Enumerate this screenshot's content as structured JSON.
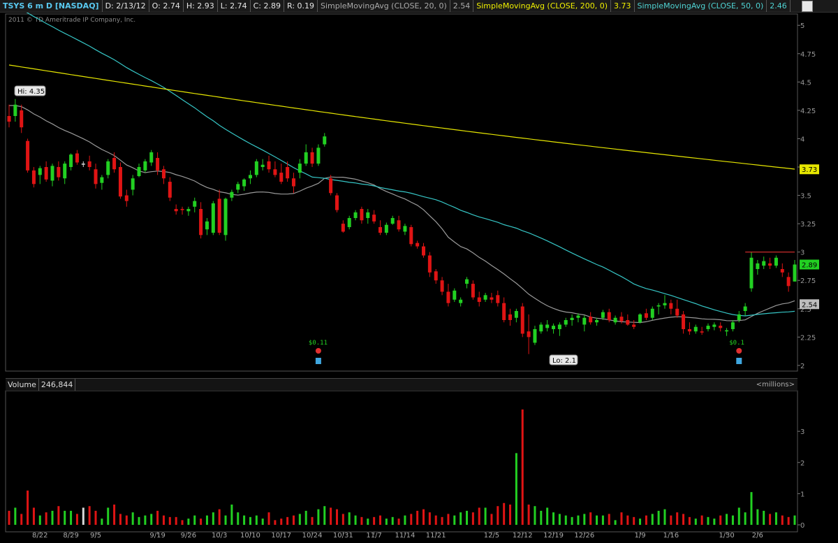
{
  "header": {
    "symbol": "TSYS 6 m D [NASDAQ]",
    "date": "D: 2/13/12",
    "open": "O: 2.74",
    "high": "H: 2.93",
    "low": "L: 2.74",
    "close": "C: 2.89",
    "range": "R: 0.19",
    "sma20_label": "SimpleMovingAvg (CLOSE, 20, 0)",
    "sma20_value": "2.54",
    "sma200_label": "SimpleMovingAvg (CLOSE, 200, 0)",
    "sma200_value": "3.73",
    "sma50_label": "SimpleMovingAvg (CLOSE, 50, 0)",
    "sma50_value": "2.46"
  },
  "copyright": "2011 © TD Ameritrade IP Company, Inc.",
  "volume_panel": {
    "label": "Volume",
    "value": "246,844",
    "units": "<millions>"
  },
  "annotations": {
    "hi": "Hi: 4.35",
    "lo": "Lo: 2.1",
    "dividend1": "$0.11",
    "dividend2": "$0.1",
    "badge_last": "2.89",
    "badge_sma200": "3.73",
    "badge_sma20": "2.54"
  },
  "colors": {
    "up": "#22d022",
    "down": "#e01414",
    "neutral": "#d8d8d8",
    "sma20": "#9a9a9a",
    "sma50": "#36c6c6",
    "sma200": "#e6e600",
    "resistance": "#e03030"
  },
  "chart_data": {
    "type": "candlestick",
    "y_ticks": [
      "5",
      "4.75",
      "4.5",
      "4.25",
      "4",
      "3.75",
      "3.5",
      "3.25",
      "3",
      "2.75",
      "2.5",
      "2.25",
      "2"
    ],
    "ylim": [
      1.95,
      5.1
    ],
    "volume_ticks": [
      "3",
      "2",
      "1",
      "0"
    ],
    "volume_ylim": [
      0,
      3.9
    ],
    "x_tick_labels": [
      {
        "label": "8/22",
        "i": 5
      },
      {
        "label": "8/29",
        "i": 10
      },
      {
        "label": "9/5",
        "i": 14
      },
      {
        "label": "9/19",
        "i": 24
      },
      {
        "label": "9/26",
        "i": 29
      },
      {
        "label": "10/3",
        "i": 34
      },
      {
        "label": "10/10",
        "i": 39
      },
      {
        "label": "10/17",
        "i": 44
      },
      {
        "label": "10/24",
        "i": 49
      },
      {
        "label": "10/31",
        "i": 54
      },
      {
        "label": "11/7",
        "i": 59
      },
      {
        "label": "11/14",
        "i": 64
      },
      {
        "label": "11/21",
        "i": 69
      },
      {
        "label": "12/5",
        "i": 78
      },
      {
        "label": "12/12",
        "i": 83
      },
      {
        "label": "12/19",
        "i": 88
      },
      {
        "label": "12/26",
        "i": 93
      },
      {
        "label": "1/9",
        "i": 102
      },
      {
        "label": "1/16",
        "i": 107
      },
      {
        "label": "1/30",
        "i": 116
      },
      {
        "label": "2/6",
        "i": 121
      }
    ],
    "ohlc": [
      [
        4.2,
        4.3,
        4.1,
        4.15
      ],
      [
        4.2,
        4.35,
        4.15,
        4.3
      ],
      [
        4.25,
        4.3,
        4.05,
        4.1
      ],
      [
        3.98,
        4.0,
        3.7,
        3.72
      ],
      [
        3.72,
        3.75,
        3.57,
        3.6
      ],
      [
        3.68,
        3.76,
        3.6,
        3.74
      ],
      [
        3.75,
        3.8,
        3.62,
        3.64
      ],
      [
        3.63,
        3.78,
        3.58,
        3.76
      ],
      [
        3.75,
        3.8,
        3.63,
        3.66
      ],
      [
        3.65,
        3.8,
        3.6,
        3.78
      ],
      [
        3.75,
        3.87,
        3.72,
        3.86
      ],
      [
        3.87,
        3.9,
        3.77,
        3.79
      ],
      [
        3.78,
        3.8,
        3.75,
        3.78
      ],
      [
        3.8,
        3.85,
        3.72,
        3.75
      ],
      [
        3.73,
        3.78,
        3.56,
        3.6
      ],
      [
        3.61,
        3.68,
        3.55,
        3.66
      ],
      [
        3.68,
        3.82,
        3.65,
        3.8
      ],
      [
        3.83,
        3.88,
        3.7,
        3.73
      ],
      [
        3.75,
        3.79,
        3.47,
        3.49
      ],
      [
        3.5,
        3.55,
        3.4,
        3.45
      ],
      [
        3.55,
        3.68,
        3.5,
        3.65
      ],
      [
        3.67,
        3.78,
        3.66,
        3.75
      ],
      [
        3.72,
        3.82,
        3.7,
        3.8
      ],
      [
        3.79,
        3.9,
        3.76,
        3.88
      ],
      [
        3.83,
        3.88,
        3.68,
        3.72
      ],
      [
        3.73,
        3.76,
        3.6,
        3.65
      ],
      [
        3.62,
        3.66,
        3.45,
        3.48
      ],
      [
        3.38,
        3.42,
        3.33,
        3.36
      ],
      [
        3.38,
        3.4,
        3.33,
        3.37
      ],
      [
        3.36,
        3.4,
        3.32,
        3.38
      ],
      [
        3.4,
        3.48,
        3.35,
        3.45
      ],
      [
        3.38,
        3.44,
        3.12,
        3.15
      ],
      [
        3.2,
        3.3,
        3.15,
        3.27
      ],
      [
        3.17,
        3.45,
        3.15,
        3.43
      ],
      [
        3.47,
        3.55,
        3.15,
        3.17
      ],
      [
        3.15,
        3.48,
        3.1,
        3.47
      ],
      [
        3.48,
        3.55,
        3.45,
        3.53
      ],
      [
        3.55,
        3.62,
        3.52,
        3.6
      ],
      [
        3.58,
        3.65,
        3.54,
        3.64
      ],
      [
        3.65,
        3.72,
        3.6,
        3.68
      ],
      [
        3.68,
        3.82,
        3.66,
        3.8
      ],
      [
        3.75,
        3.82,
        3.72,
        3.77
      ],
      [
        3.8,
        3.85,
        3.7,
        3.73
      ],
      [
        3.73,
        3.8,
        3.66,
        3.68
      ],
      [
        3.7,
        3.78,
        3.6,
        3.62
      ],
      [
        3.75,
        3.8,
        3.62,
        3.65
      ],
      [
        3.65,
        3.7,
        3.52,
        3.58
      ],
      [
        3.7,
        3.82,
        3.65,
        3.78
      ],
      [
        3.78,
        3.95,
        3.76,
        3.88
      ],
      [
        3.88,
        3.92,
        3.75,
        3.78
      ],
      [
        3.78,
        3.95,
        3.76,
        3.92
      ],
      [
        3.95,
        4.05,
        3.93,
        4.02
      ],
      [
        3.65,
        3.68,
        3.5,
        3.52
      ],
      [
        3.5,
        3.52,
        3.35,
        3.37
      ],
      [
        3.25,
        3.28,
        3.17,
        3.18
      ],
      [
        3.22,
        3.32,
        3.2,
        3.3
      ],
      [
        3.3,
        3.37,
        3.28,
        3.35
      ],
      [
        3.38,
        3.4,
        3.25,
        3.28
      ],
      [
        3.3,
        3.38,
        3.25,
        3.35
      ],
      [
        3.33,
        3.37,
        3.25,
        3.27
      ],
      [
        3.22,
        3.28,
        3.15,
        3.17
      ],
      [
        3.17,
        3.26,
        3.15,
        3.24
      ],
      [
        3.25,
        3.32,
        3.24,
        3.3
      ],
      [
        3.28,
        3.32,
        3.18,
        3.2
      ],
      [
        3.18,
        3.25,
        3.15,
        3.23
      ],
      [
        3.22,
        3.24,
        3.05,
        3.07
      ],
      [
        3.08,
        3.1,
        3.03,
        3.05
      ],
      [
        3.05,
        3.08,
        2.95,
        2.97
      ],
      [
        2.97,
        3.0,
        2.78,
        2.82
      ],
      [
        2.83,
        2.85,
        2.72,
        2.75
      ],
      [
        2.75,
        2.78,
        2.62,
        2.65
      ],
      [
        2.65,
        2.72,
        2.52,
        2.55
      ],
      [
        2.58,
        2.68,
        2.56,
        2.66
      ],
      [
        2.55,
        2.6,
        2.52,
        2.58
      ],
      [
        2.72,
        2.78,
        2.68,
        2.76
      ],
      [
        2.72,
        2.75,
        2.58,
        2.6
      ],
      [
        2.6,
        2.65,
        2.52,
        2.56
      ],
      [
        2.58,
        2.64,
        2.56,
        2.62
      ],
      [
        2.6,
        2.64,
        2.55,
        2.58
      ],
      [
        2.62,
        2.66,
        2.52,
        2.55
      ],
      [
        2.55,
        2.6,
        2.38,
        2.4
      ],
      [
        2.45,
        2.5,
        2.35,
        2.4
      ],
      [
        2.42,
        2.5,
        2.38,
        2.48
      ],
      [
        2.52,
        2.55,
        2.25,
        2.28
      ],
      [
        2.3,
        2.45,
        2.1,
        2.25
      ],
      [
        2.2,
        2.35,
        2.18,
        2.32
      ],
      [
        2.3,
        2.38,
        2.28,
        2.36
      ],
      [
        2.33,
        2.4,
        2.3,
        2.36
      ],
      [
        2.32,
        2.37,
        2.28,
        2.35
      ],
      [
        2.32,
        2.38,
        2.26,
        2.36
      ],
      [
        2.36,
        2.42,
        2.34,
        2.4
      ],
      [
        2.4,
        2.45,
        2.35,
        2.42
      ],
      [
        2.42,
        2.46,
        2.38,
        2.44
      ],
      [
        2.36,
        2.44,
        2.3,
        2.42
      ],
      [
        2.43,
        2.47,
        2.36,
        2.38
      ],
      [
        2.38,
        2.42,
        2.35,
        2.4
      ],
      [
        2.42,
        2.49,
        2.4,
        2.47
      ],
      [
        2.47,
        2.5,
        2.38,
        2.4
      ],
      [
        2.38,
        2.44,
        2.36,
        2.42
      ],
      [
        2.43,
        2.47,
        2.37,
        2.39
      ],
      [
        2.4,
        2.45,
        2.35,
        2.36
      ],
      [
        2.36,
        2.4,
        2.32,
        2.34
      ],
      [
        2.38,
        2.46,
        2.37,
        2.45
      ],
      [
        2.46,
        2.5,
        2.4,
        2.42
      ],
      [
        2.42,
        2.52,
        2.4,
        2.5
      ],
      [
        2.52,
        2.55,
        2.45,
        2.53
      ],
      [
        2.53,
        2.62,
        2.5,
        2.55
      ],
      [
        2.55,
        2.58,
        2.45,
        2.5
      ],
      [
        2.5,
        2.58,
        2.42,
        2.44
      ],
      [
        2.45,
        2.48,
        2.28,
        2.32
      ],
      [
        2.32,
        2.38,
        2.27,
        2.3
      ],
      [
        2.3,
        2.36,
        2.28,
        2.34
      ],
      [
        2.3,
        2.34,
        2.27,
        2.29
      ],
      [
        2.32,
        2.37,
        2.3,
        2.35
      ],
      [
        2.34,
        2.38,
        2.31,
        2.36
      ],
      [
        2.35,
        2.38,
        2.3,
        2.33
      ],
      [
        2.3,
        2.33,
        2.26,
        2.31
      ],
      [
        2.32,
        2.4,
        2.3,
        2.38
      ],
      [
        2.4,
        2.48,
        2.38,
        2.45
      ],
      [
        2.48,
        2.55,
        2.44,
        2.52
      ],
      [
        2.68,
        3.0,
        2.65,
        2.95
      ],
      [
        2.85,
        2.93,
        2.8,
        2.9
      ],
      [
        2.88,
        2.96,
        2.85,
        2.92
      ],
      [
        2.9,
        2.95,
        2.85,
        2.88
      ],
      [
        2.88,
        2.97,
        2.86,
        2.95
      ],
      [
        2.85,
        2.9,
        2.78,
        2.82
      ],
      [
        2.78,
        2.82,
        2.65,
        2.7
      ],
      [
        2.74,
        2.93,
        2.74,
        2.89
      ]
    ],
    "volume": [
      0.45,
      0.55,
      0.35,
      1.1,
      0.55,
      0.3,
      0.4,
      0.45,
      0.6,
      0.45,
      0.45,
      0.35,
      0.55,
      0.6,
      0.45,
      0.2,
      0.55,
      0.65,
      0.35,
      0.3,
      0.4,
      0.25,
      0.3,
      0.35,
      0.45,
      0.3,
      0.25,
      0.25,
      0.15,
      0.2,
      0.3,
      0.2,
      0.3,
      0.4,
      0.5,
      0.3,
      0.65,
      0.4,
      0.3,
      0.25,
      0.3,
      0.2,
      0.4,
      0.15,
      0.2,
      0.25,
      0.3,
      0.35,
      0.45,
      0.25,
      0.5,
      0.6,
      0.55,
      0.5,
      0.35,
      0.4,
      0.3,
      0.25,
      0.2,
      0.25,
      0.3,
      0.2,
      0.25,
      0.2,
      0.3,
      0.35,
      0.45,
      0.5,
      0.4,
      0.3,
      0.25,
      0.35,
      0.3,
      0.4,
      0.45,
      0.4,
      0.55,
      0.55,
      0.35,
      0.6,
      0.7,
      0.65,
      2.3,
      3.7,
      0.65,
      0.6,
      0.45,
      0.55,
      0.4,
      0.35,
      0.3,
      0.25,
      0.3,
      0.35,
      0.4,
      0.3,
      0.3,
      0.35,
      0.15,
      0.4,
      0.3,
      0.25,
      0.2,
      0.3,
      0.35,
      0.45,
      0.5,
      0.3,
      0.4,
      0.35,
      0.25,
      0.2,
      0.3,
      0.25,
      0.2,
      0.3,
      0.35,
      0.3,
      0.55,
      0.4,
      1.05,
      0.5,
      0.45,
      0.35,
      0.4,
      0.3,
      0.25,
      0.3
    ]
  }
}
